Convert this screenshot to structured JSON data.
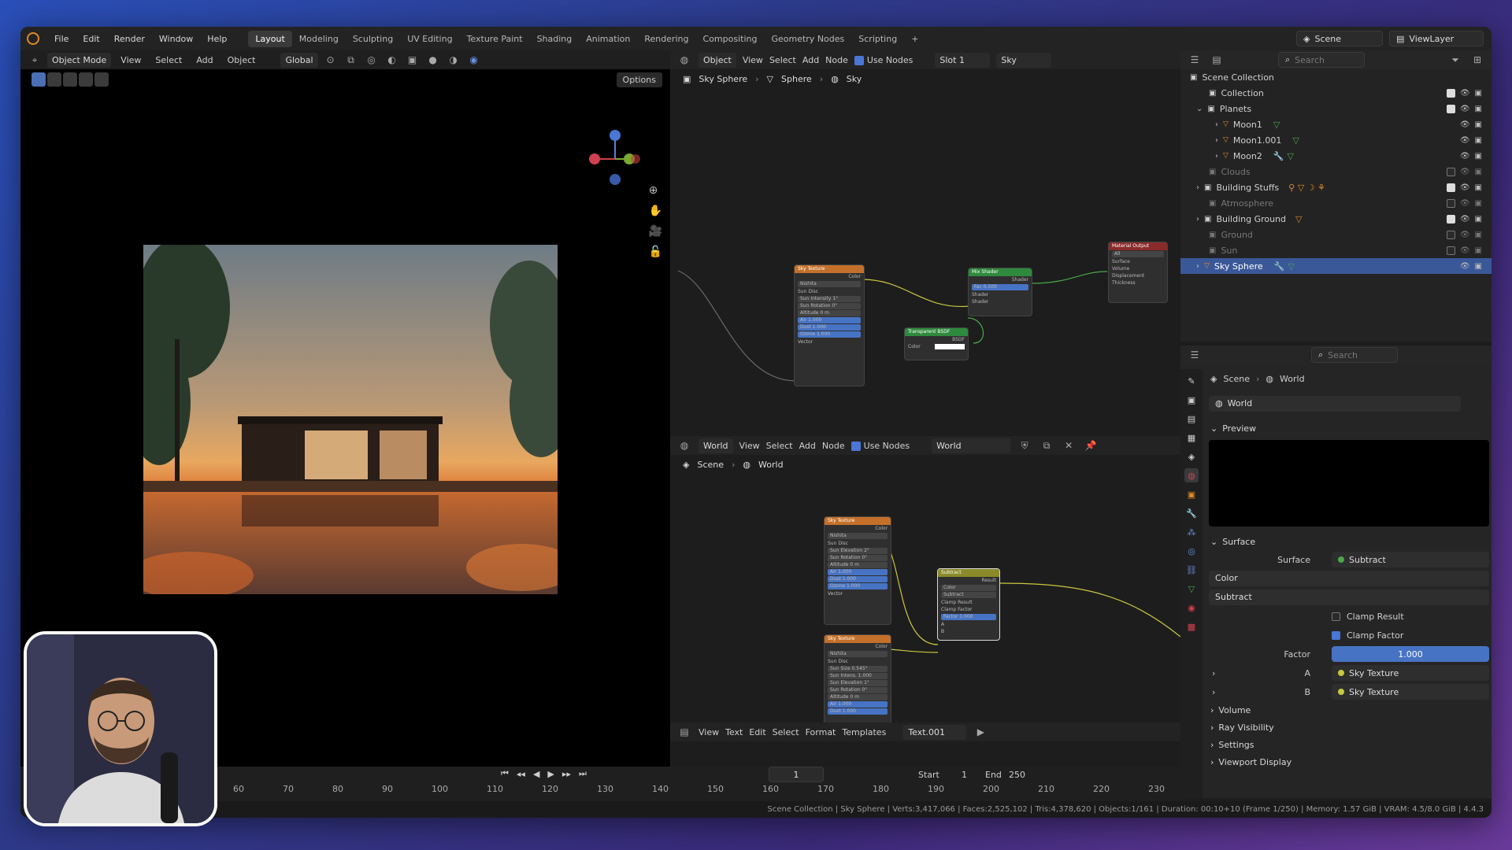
{
  "topbar": {
    "menus": [
      "File",
      "Edit",
      "Render",
      "Window",
      "Help"
    ],
    "workspaces": [
      "Layout",
      "Modeling",
      "Sculpting",
      "UV Editing",
      "Texture Paint",
      "Shading",
      "Animation",
      "Rendering",
      "Compositing",
      "Geometry Nodes",
      "Scripting"
    ],
    "active_workspace": "Layout",
    "add_tab": "+",
    "scene": "Scene",
    "view_layer": "ViewLayer"
  },
  "viewport": {
    "mode": "Object Mode",
    "menus": [
      "View",
      "Select",
      "Add",
      "Object"
    ],
    "transform": "Global",
    "options": "Options"
  },
  "node_editor_top": {
    "type": "Object",
    "menus": [
      "View",
      "Select",
      "Add",
      "Node"
    ],
    "use_nodes": "Use Nodes",
    "slot": "Slot 1",
    "material": "Sky",
    "breadcrumb": [
      "Sky Sphere",
      "Sphere",
      "Sky"
    ],
    "nodes": {
      "sky_texture": {
        "title": "Sky Texture",
        "rows": [
          "Color",
          "Nishita",
          "Sun Disc",
          "Sun Intensity  1°",
          "Sun Rotation  0°",
          "Altitude  0 m",
          "Air  1.000",
          "Dust  1.000",
          "Ozone  1.000",
          "Vector"
        ]
      },
      "mix_shader": {
        "title": "Mix Shader",
        "rows": [
          "Shader",
          "Fac  0.500",
          "Shader",
          "Shader"
        ]
      },
      "transparent": {
        "title": "Transparent BSDF",
        "rows": [
          "BSDF",
          "Color"
        ]
      },
      "material_output": {
        "title": "Material Output",
        "rows": [
          "All",
          "Surface",
          "Volume",
          "Displacement",
          "Thickness"
        ]
      }
    }
  },
  "node_editor_bottom": {
    "type": "World",
    "menus": [
      "View",
      "Select",
      "Add",
      "Node"
    ],
    "use_nodes": "Use Nodes",
    "world": "World",
    "breadcrumb": [
      "Scene",
      "World"
    ],
    "nodes": {
      "sky_a": {
        "title": "Sky Texture",
        "rows": [
          "Color",
          "Nishita",
          "Sun Disc",
          "Sun Elevation  2°",
          "Sun Rotation  0°",
          "Altitude  0 m",
          "Air  1.000",
          "Dust  1.000",
          "Ozone  1.000",
          "Vector"
        ]
      },
      "sky_b": {
        "title": "Sky Texture",
        "rows": [
          "Color",
          "Nishita",
          "Sun Disc",
          "Sun Size  0.545°",
          "Sun Intens.  1.000",
          "Sun Elevation  1°",
          "Sun Rotation  0°",
          "Altitude  0 m",
          "Air  1.000",
          "Dust  1.000"
        ]
      },
      "subtract": {
        "title": "Subtract",
        "rows": [
          "Result",
          "Color",
          "Subtract",
          "Clamp Result",
          "Clamp Factor",
          "Factor  1.000",
          "A",
          "B"
        ]
      }
    }
  },
  "text_editor": {
    "menus": [
      "View",
      "Text",
      "Edit",
      "Select",
      "Format",
      "Templates"
    ],
    "file": "Text.001"
  },
  "timeline": {
    "frame": "1",
    "start_label": "Start",
    "start": "1",
    "end_label": "End",
    "end": "250",
    "ticks": [
      "60",
      "70",
      "80",
      "90",
      "100",
      "110",
      "120",
      "130",
      "140",
      "150",
      "160",
      "170",
      "180",
      "190",
      "200",
      "210",
      "220",
      "230"
    ]
  },
  "outliner": {
    "search": "Search",
    "root": "Scene Collection",
    "rows": [
      {
        "label": "Collection",
        "indent": 1,
        "dim": false
      },
      {
        "label": "Planets",
        "indent": 1,
        "dim": false
      },
      {
        "label": "Moon1",
        "indent": 2,
        "dim": false
      },
      {
        "label": "Moon1.001",
        "indent": 2,
        "dim": false
      },
      {
        "label": "Moon2",
        "indent": 2,
        "dim": false
      },
      {
        "label": "Clouds",
        "indent": 1,
        "dim": true
      },
      {
        "label": "Building Stuffs",
        "indent": 1,
        "dim": false
      },
      {
        "label": "Atmosphere",
        "indent": 1,
        "dim": true
      },
      {
        "label": "Building Ground",
        "indent": 1,
        "dim": false
      },
      {
        "label": "Ground",
        "indent": 1,
        "dim": true
      },
      {
        "label": "Sun",
        "indent": 1,
        "dim": true
      },
      {
        "label": "Sky Sphere",
        "indent": 1,
        "dim": false
      }
    ]
  },
  "properties": {
    "search": "Search",
    "breadcrumb": [
      "Scene",
      "World"
    ],
    "world_name": "World",
    "preview": "Preview",
    "surface_panel": "Surface",
    "surface_label": "Surface",
    "surface_value": "Subtract",
    "color_mode": "Color",
    "blend_mode": "Subtract",
    "clamp_result": "Clamp Result",
    "clamp_factor": "Clamp Factor",
    "factor_label": "Factor",
    "factor_value": "1.000",
    "a_label": "A",
    "a_value": "Sky Texture",
    "b_label": "B",
    "b_value": "Sky Texture",
    "volume": "Volume",
    "ray_visibility": "Ray Visibility",
    "settings": "Settings",
    "viewport_display": "Viewport Display"
  },
  "statusbar": "Scene Collection | Sky Sphere | Verts:3,417,066 | Faces:2,525,102 | Tris:4,378,620 | Objects:1/161 | Duration: 00:10+10 (Frame 1/250) | Memory: 1.57 GiB | VRAM: 4.5/8.0 GiB | 4.4.3",
  "colors": {
    "accent": "#4773c4",
    "selection": "#3a5898",
    "node_sky": "#c4702a",
    "node_shader": "#2e8a3c",
    "node_output": "#8a2a2a",
    "node_mix": "#8a8a2a"
  }
}
